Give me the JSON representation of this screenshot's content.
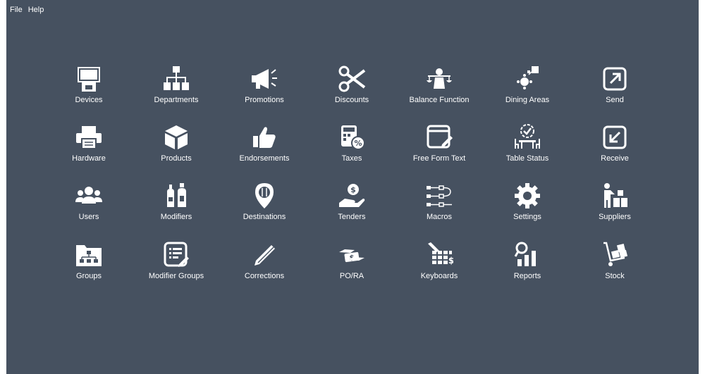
{
  "menu": {
    "file": "File",
    "help": "Help"
  },
  "tiles": [
    {
      "label": "Devices",
      "icon": "devices-icon"
    },
    {
      "label": "Departments",
      "icon": "departments-icon"
    },
    {
      "label": "Promotions",
      "icon": "promotions-icon"
    },
    {
      "label": "Discounts",
      "icon": "discounts-icon"
    },
    {
      "label": "Balance Function",
      "icon": "balance-function-icon"
    },
    {
      "label": "Dining Areas",
      "icon": "dining-areas-icon"
    },
    {
      "label": "Send",
      "icon": "send-icon"
    },
    {
      "label": "Hardware",
      "icon": "hardware-icon"
    },
    {
      "label": "Products",
      "icon": "products-icon"
    },
    {
      "label": "Endorsements",
      "icon": "endorsements-icon"
    },
    {
      "label": "Taxes",
      "icon": "taxes-icon"
    },
    {
      "label": "Free Form Text",
      "icon": "free-form-text-icon"
    },
    {
      "label": "Table Status",
      "icon": "table-status-icon"
    },
    {
      "label": "Receive",
      "icon": "receive-icon"
    },
    {
      "label": "Users",
      "icon": "users-icon"
    },
    {
      "label": "Modifiers",
      "icon": "modifiers-icon"
    },
    {
      "label": "Destinations",
      "icon": "destinations-icon"
    },
    {
      "label": "Tenders",
      "icon": "tenders-icon"
    },
    {
      "label": "Macros",
      "icon": "macros-icon"
    },
    {
      "label": "Settings",
      "icon": "settings-icon"
    },
    {
      "label": "Suppliers",
      "icon": "suppliers-icon"
    },
    {
      "label": "Groups",
      "icon": "groups-icon"
    },
    {
      "label": "Modifier Groups",
      "icon": "modifier-groups-icon"
    },
    {
      "label": "Corrections",
      "icon": "corrections-icon"
    },
    {
      "label": "PO/RA",
      "icon": "po-ra-icon"
    },
    {
      "label": "Keyboards",
      "icon": "keyboards-icon"
    },
    {
      "label": "Reports",
      "icon": "reports-icon"
    },
    {
      "label": "Stock",
      "icon": "stock-icon"
    }
  ]
}
